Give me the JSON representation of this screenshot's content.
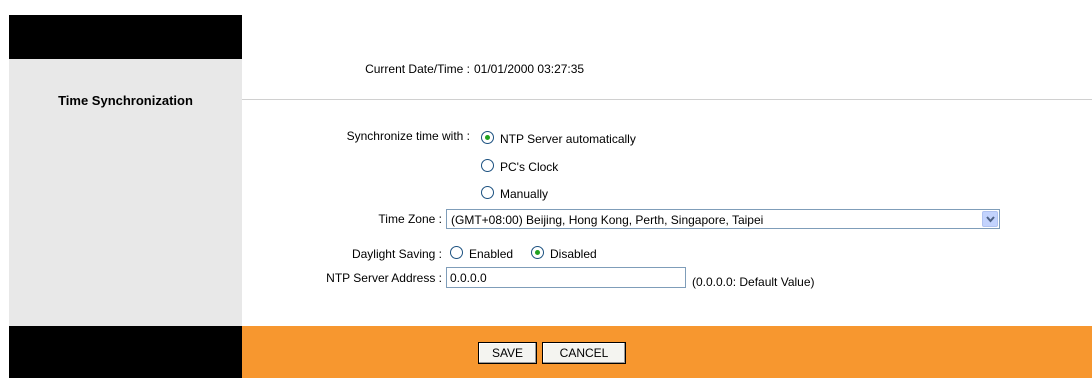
{
  "section_title": "Time Synchronization",
  "current_datetime": {
    "label": "Current Date/Time :",
    "value": "01/01/2000 03:27:35"
  },
  "sync": {
    "label": "Synchronize time with :",
    "options": [
      "NTP Server automatically",
      "PC's Clock",
      "Manually"
    ],
    "selected": "NTP Server automatically"
  },
  "time_zone": {
    "label": "Time Zone :",
    "value": "(GMT+08:00) Beijing, Hong Kong, Perth, Singapore, Taipei"
  },
  "daylight_saving": {
    "label": "Daylight Saving :",
    "options": [
      "Enabled",
      "Disabled"
    ],
    "selected": "Disabled"
  },
  "ntp_server": {
    "label": "NTP Server Address :",
    "value": "0.0.0.0",
    "hint": "(0.0.0.0: Default Value)"
  },
  "buttons": {
    "save": "SAVE",
    "cancel": "CANCEL"
  },
  "colors": {
    "footer_orange": "#f7972f",
    "sidebar_gray": "#e8e8e8",
    "black": "#000000"
  }
}
